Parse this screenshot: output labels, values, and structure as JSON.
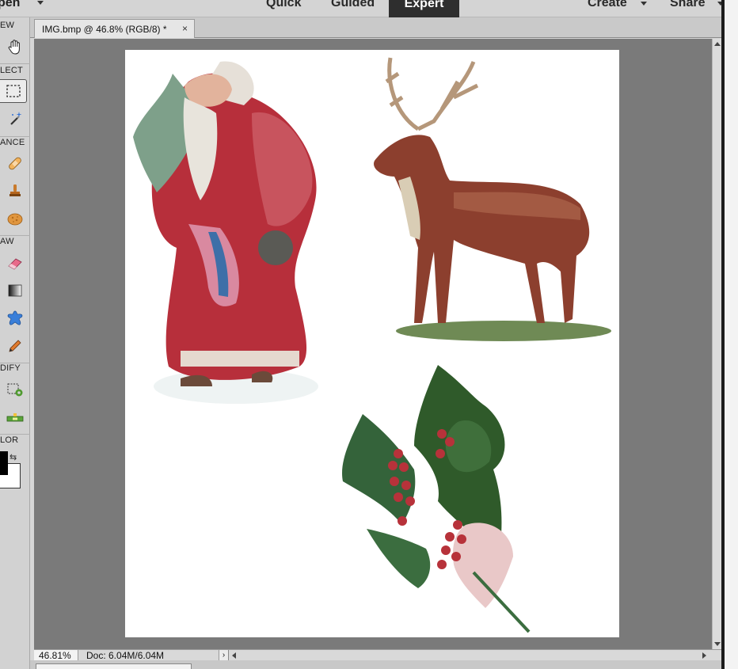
{
  "topbar": {
    "open_label": "pen",
    "modes": {
      "quick": "Quick",
      "guided": "Guided",
      "expert": "Expert"
    },
    "create_label": "Create",
    "share_label": "Share"
  },
  "toolbox": {
    "sections": {
      "view": "EW",
      "select": "LECT",
      "enhance": "ANCE",
      "draw": "AW",
      "modify": "DIFY",
      "color": "LOR"
    },
    "tools": [
      {
        "name": "hand-tool",
        "icon": "hand-icon"
      },
      {
        "name": "rectangular-marquee-tool",
        "icon": "marquee-icon"
      },
      {
        "name": "magic-wand-tool",
        "icon": "magic-wand-icon"
      },
      {
        "name": "spot-healing-brush-tool",
        "icon": "bandage-icon"
      },
      {
        "name": "clone-stamp-tool",
        "icon": "stamp-icon"
      },
      {
        "name": "sponge-tool",
        "icon": "sponge-icon"
      },
      {
        "name": "eraser-tool",
        "icon": "eraser-icon"
      },
      {
        "name": "gradient-tool",
        "icon": "gradient-icon"
      },
      {
        "name": "custom-shape-tool",
        "icon": "puzzle-shape-icon"
      },
      {
        "name": "pencil-tool",
        "icon": "pencil-icon"
      },
      {
        "name": "recompose-tool",
        "icon": "recompose-icon"
      },
      {
        "name": "straighten-tool",
        "icon": "level-icon"
      }
    ],
    "colors": {
      "foreground": "#000000",
      "background": "#ffffff"
    }
  },
  "document": {
    "tab_title": "IMG.bmp @ 46.8% (RGB/8) *",
    "close_glyph": "×"
  },
  "status": {
    "zoom": "46.81%",
    "doc_info": "Doc: 6.04M/6.04M",
    "arrow": "›"
  },
  "colors": {
    "accent_mode": "#2e2e2e",
    "canvas_bg": "#7a7a7a"
  }
}
